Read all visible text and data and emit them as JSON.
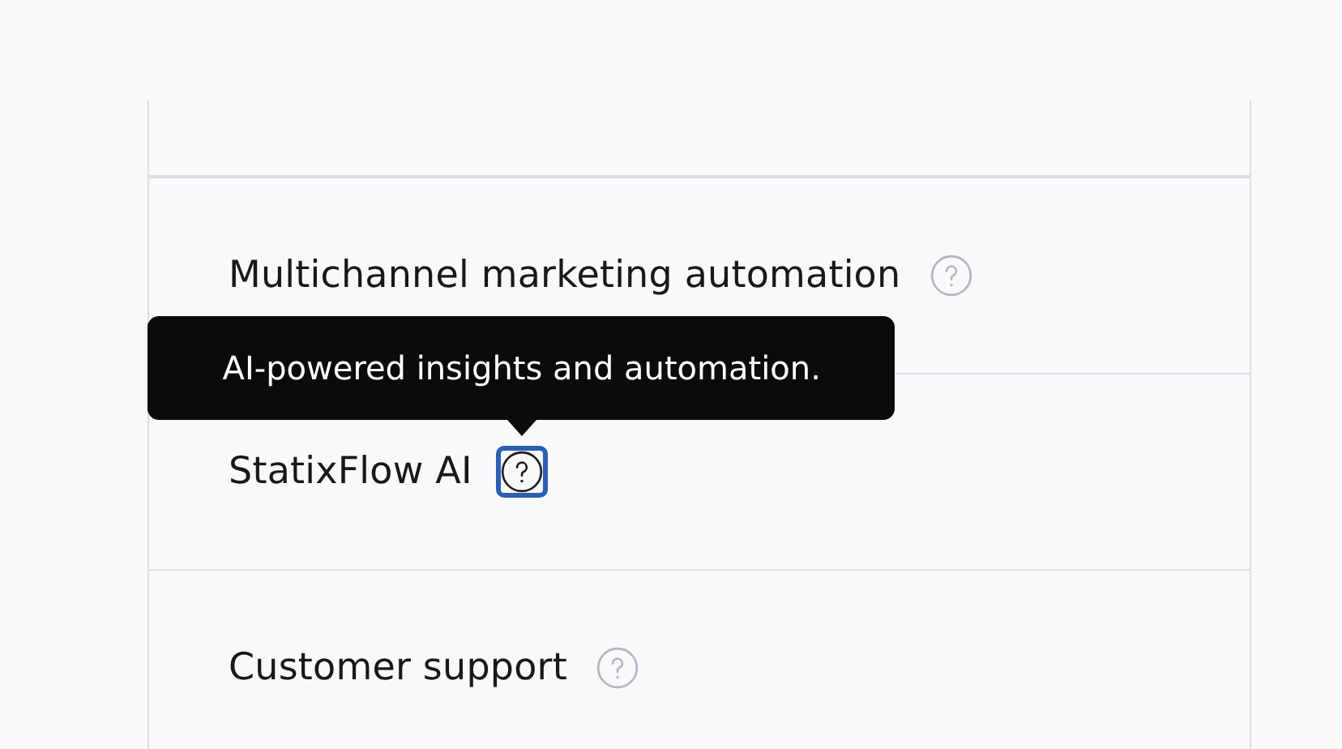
{
  "rows": [
    {
      "label": "Multichannel marketing automation",
      "help_focused": false
    },
    {
      "label": "StatixFlow AI",
      "help_focused": true,
      "tooltip": "AI-powered insights and automation."
    },
    {
      "label": "Customer support",
      "help_focused": false
    }
  ]
}
